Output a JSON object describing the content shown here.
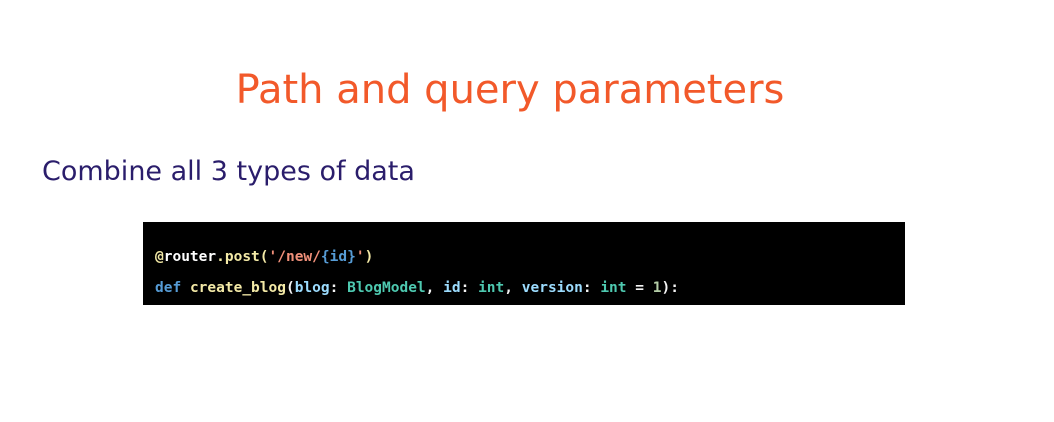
{
  "slide": {
    "title": "Path and query parameters",
    "subtitle": "Combine all 3 types of data"
  },
  "code": {
    "line1": {
      "at": "@",
      "router": "router",
      "dot_post": ".post(",
      "quote_open": "'/new/",
      "brace_id": "{id}",
      "quote_close": "'",
      "paren_close": ")"
    },
    "line2": {
      "def": "def",
      "func": "create_blog",
      "paren_open": "(",
      "p_blog": "blog",
      "colon1": ": ",
      "t_blogmodel": "BlogModel",
      "comma1": ", ",
      "p_id": "id",
      "colon2": ": ",
      "t_int1": "int",
      "comma2": ", ",
      "p_version": "version",
      "colon3": ": ",
      "t_int2": "int",
      "eq": " = ",
      "num": "1",
      "end": "):"
    }
  },
  "colors": {
    "title": "#f2592a",
    "subtitle": "#2a1d6b",
    "code_background": "#000000"
  }
}
